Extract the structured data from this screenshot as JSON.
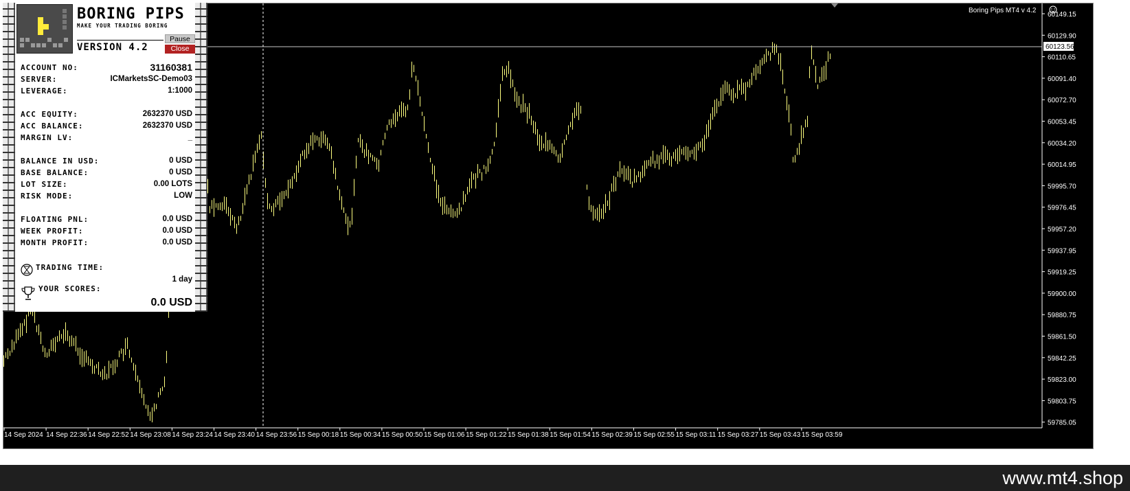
{
  "panel": {
    "brand_title": "BORING PIPS",
    "brand_subtitle": "MAKE YOUR TRADING BORING",
    "version": "VERSION 4.2",
    "pause_label": "Pause",
    "close_label": "Close",
    "rows": [
      {
        "label": "ACCOUNT NO:",
        "value": "31160381"
      },
      {
        "label": "SERVER:",
        "value": "ICMarketsSC-Demo03"
      },
      {
        "label": "LEVERAGE:",
        "value": "1:1000"
      },
      {
        "label": "ACC EQUITY:",
        "value": "2632370 USD"
      },
      {
        "label": "ACC BALANCE:",
        "value": "2632370 USD"
      },
      {
        "label": "MARGIN LV:",
        "value": "_"
      },
      {
        "label": "BALANCE IN USD:",
        "value": "0 USD"
      },
      {
        "label": "BASE BALANCE:",
        "value": "0 USD"
      },
      {
        "label": "LOT SIZE:",
        "value": "0.00 LOTS"
      },
      {
        "label": "RISK MODE:",
        "value": "LOW"
      },
      {
        "label": "FLOATING PNL:",
        "value": "0.0 USD"
      },
      {
        "label": "WEEK PROFIT:",
        "value": "0.0 USD"
      },
      {
        "label": "MONTH PROFIT:",
        "value": "0.0 USD"
      }
    ],
    "trading_time_label": "TRADING TIME:",
    "trading_time_value": "1 day",
    "scores_label": "YOUR SCORES:",
    "scores_value": "0.0 USD",
    "icons": {
      "logo": "tetris-block-icon",
      "clock": "hourglass-icon",
      "trophy": "trophy-icon"
    }
  },
  "chart": {
    "indicator_label": "Boring Pips MT4 v 4.2",
    "current_price": "60123.56",
    "price_labels": [
      "60149.15",
      "60129.90",
      "60110.65",
      "60091.40",
      "60072.70",
      "60053.45",
      "60034.20",
      "60014.95",
      "59995.70",
      "59976.45",
      "59957.20",
      "59937.95",
      "59919.25",
      "59900.00",
      "59880.75",
      "59861.50",
      "59842.25",
      "59823.00",
      "59803.75",
      "59785.05"
    ],
    "time_labels": [
      "14 Sep 2024",
      "14 Sep 22:36",
      "14 Sep 22:52",
      "14 Sep 23:08",
      "14 Sep 23:24",
      "14 Sep 23:40",
      "14 Sep 23:56",
      "15 Sep 00:18",
      "15 Sep 00:34",
      "15 Sep 00:50",
      "15 Sep 01:06",
      "15 Sep 01:22",
      "15 Sep 01:38",
      "15 Sep 01:54",
      "15 Sep 02:39",
      "15 Sep 02:55",
      "15 Sep 03:11",
      "15 Sep 03:27",
      "15 Sep 03:43",
      "15 Sep 03:59"
    ],
    "colors": {
      "background": "#000000",
      "bars": "#ffff80",
      "grid": "#ffffff"
    }
  },
  "footer": {
    "site_url": "www.mt4.shop"
  }
}
